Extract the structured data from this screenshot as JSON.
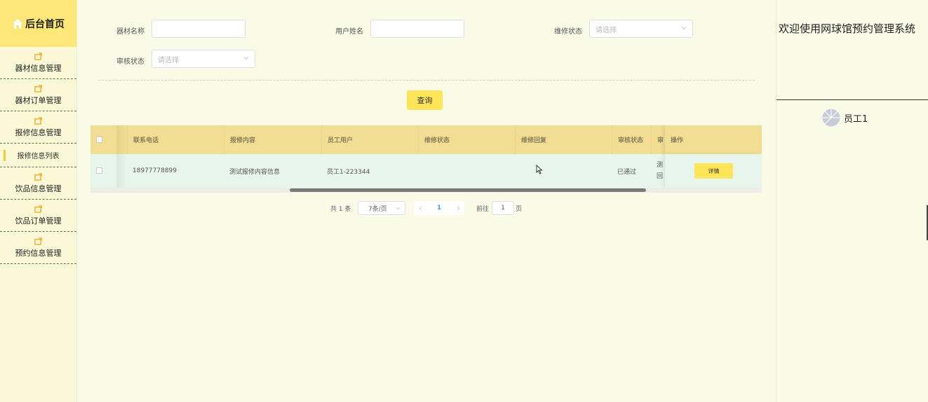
{
  "sidebar": {
    "title": "后台首页",
    "items": [
      {
        "label": "器材信息管理"
      },
      {
        "label": "器材订单管理"
      },
      {
        "label": "报修信息管理"
      },
      {
        "label": "饮品信息管理"
      },
      {
        "label": "饮品订单管理"
      },
      {
        "label": "预约信息管理"
      }
    ],
    "active_submenu": "报修信息列表"
  },
  "header": {
    "welcome": "欢迎使用网球馆预约管理系统",
    "user_name": "员工1"
  },
  "search": {
    "equipment_name_label": "器材名称",
    "equipment_name_value": "",
    "user_name_label": "用户姓名",
    "user_name_value": "",
    "repair_status_label": "维修状态",
    "repair_status_placeholder": "请选择",
    "review_status_label": "审核状态",
    "review_status_placeholder": "请选择",
    "query_button": "查询"
  },
  "table": {
    "columns": [
      "联系电话",
      "报修内容",
      "员工用户",
      "维修状态",
      "维修回复",
      "审核状态",
      "审",
      "操作"
    ],
    "rows": [
      {
        "phone": "18977778899",
        "content": "测试报修内容信息",
        "employee": "员工1-223344",
        "repair_status": "",
        "repair_reply": "",
        "review_status": "已通过",
        "review_reply_line1": "测",
        "review_reply_line2": "回",
        "action": "详情"
      }
    ]
  },
  "pagination": {
    "total_text": "共 1 条",
    "page_size": "7条/页",
    "current_page": "1",
    "goto_prefix": "前往",
    "goto_value": "1",
    "goto_suffix": "页"
  },
  "colors": {
    "accent_yellow": "#fde458",
    "header_yellow": "#f2de93",
    "row_green": "#e7f5ed",
    "background": "#f9fbe7"
  }
}
